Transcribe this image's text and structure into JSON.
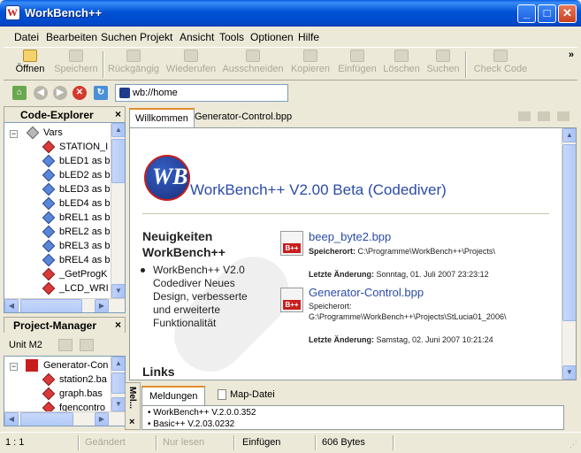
{
  "window": {
    "title": "WorkBench++",
    "controls": [
      "minimize-icon",
      "maximize-icon",
      "close-icon"
    ]
  },
  "menu": {
    "items": [
      "Datei",
      "Bearbeiten",
      "Suchen",
      "Projekt",
      "Ansicht",
      "Tools",
      "Optionen",
      "Hilfe"
    ]
  },
  "toolbar": {
    "buttons": [
      {
        "label": "Öffnen",
        "icon": "folder-open-icon",
        "enabled": true
      },
      {
        "label": "Speichern",
        "icon": "save-icon",
        "enabled": false
      },
      {
        "label": "Rückgängig",
        "icon": "undo-icon",
        "enabled": false
      },
      {
        "label": "Wiederufen",
        "icon": "redo-icon",
        "enabled": false
      },
      {
        "label": "Ausschneiden",
        "icon": "cut-icon",
        "enabled": false
      },
      {
        "label": "Kopieren",
        "icon": "copy-icon",
        "enabled": false
      },
      {
        "label": "Einfügen",
        "icon": "paste-icon",
        "enabled": false
      },
      {
        "label": "Löschen",
        "icon": "delete-icon",
        "enabled": false
      },
      {
        "label": "Suchen",
        "icon": "search-icon",
        "enabled": false
      },
      {
        "label": "Check Code",
        "icon": "check-code-icon",
        "enabled": false
      }
    ],
    "overflow": "»"
  },
  "address": {
    "value": "wb://home",
    "nav_icons": [
      "home-icon",
      "back-icon",
      "forward-icon",
      "stop-icon",
      "refresh-icon"
    ]
  },
  "code_explorer": {
    "title": "Code-Explorer",
    "close": "×",
    "root": "Vars",
    "items": [
      {
        "label": "STATION_I",
        "color": "red"
      },
      {
        "label": "bLED1 as b",
        "color": "blue"
      },
      {
        "label": "bLED2 as b",
        "color": "blue"
      },
      {
        "label": "bLED3 as b",
        "color": "blue"
      },
      {
        "label": "bLED4 as b",
        "color": "blue"
      },
      {
        "label": "bREL1 as b",
        "color": "blue"
      },
      {
        "label": "bREL2 as b",
        "color": "blue"
      },
      {
        "label": "bREL3 as b",
        "color": "blue"
      },
      {
        "label": "bREL4 as b",
        "color": "blue"
      },
      {
        "label": "_GetProgK",
        "color": "red"
      },
      {
        "label": "_LCD_WRI",
        "color": "red"
      }
    ]
  },
  "project_manager": {
    "title": "Project-Manager",
    "close": "×",
    "unit_label": "Unit M2",
    "root": "Generator-Con",
    "items": [
      "station2.ba",
      "graph.bas",
      "fgencontro"
    ]
  },
  "tabs": {
    "items": [
      "Willkommen",
      "Generator-Control.bpp"
    ],
    "active": 0
  },
  "welcome": {
    "heading": "WorkBench++ V2.00 Beta (Codediver)",
    "news_title_line1": "Neuigkeiten",
    "news_title_line2": "WorkBench++",
    "news_item": "WorkBench++ V2.0 Codediver Neues Design, verbesserte und erweiterte Funktionalität",
    "links_title": "Links",
    "files": [
      {
        "name": "beep_byte2.bpp",
        "location_label": "Speicherort:",
        "location": "C:\\Programme\\WorkBench++\\Projects\\",
        "modified_label": "Letzte Änderung:",
        "modified": "Sonntag, 01. Juli 2007 23:23:12"
      },
      {
        "name": "Generator-Control.bpp",
        "location_label": "Speicherort:",
        "location": "G:\\Programme\\WorkBench++\\Projects\\StLucia01_2006\\",
        "modified_label": "Letzte Änderung:",
        "modified": "Samstag, 02. Juni 2007 10:21:24"
      }
    ],
    "badge": "B++"
  },
  "bottom_panel": {
    "side_title": "Mel...",
    "close": "×",
    "tabs": [
      "Meldungen",
      "Map-Datei"
    ],
    "active": 0,
    "log": [
      "WorkBench++ V.2.0.0.352",
      "Basic++ V.2.03.0232"
    ]
  },
  "status": {
    "position": "1 : 1",
    "modified": "Geändert",
    "readonly": "Nur lesen",
    "mode": "Einfügen",
    "size": "606 Bytes"
  },
  "colors": {
    "title_blue": "#0052d6",
    "link_blue": "#2b4ba8",
    "accent_orange": "#e68b2c",
    "badge_red": "#c81e1e"
  }
}
